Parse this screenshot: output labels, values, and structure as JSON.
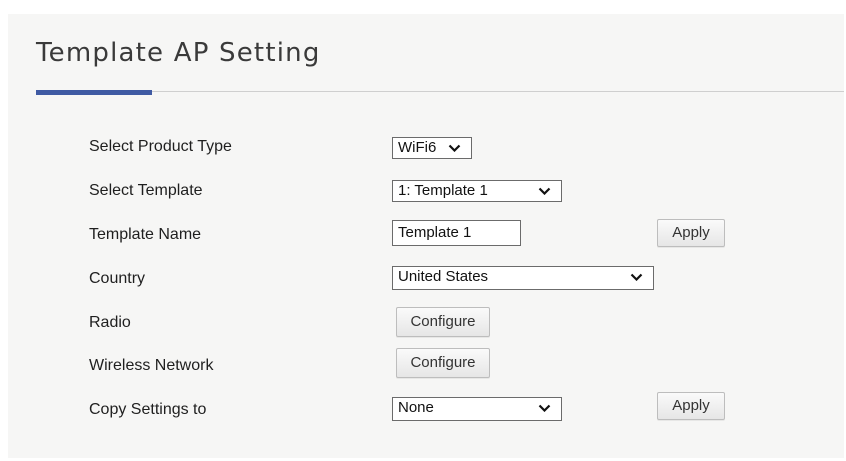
{
  "page": {
    "title": "Template AP Setting"
  },
  "rows": {
    "product_type": {
      "label": "Select Product Type",
      "value": "WiFi6"
    },
    "template": {
      "label": "Select Template",
      "value": "1: Template 1"
    },
    "template_name": {
      "label": "Template Name",
      "value": "Template 1",
      "apply_label": "Apply"
    },
    "country": {
      "label": "Country",
      "value": "United States"
    },
    "radio": {
      "label": "Radio",
      "button_label": "Configure"
    },
    "wireless_network": {
      "label": "Wireless Network",
      "button_label": "Configure"
    },
    "copy_settings": {
      "label": "Copy Settings to",
      "value": "None",
      "apply_label": "Apply"
    }
  },
  "colors": {
    "accent": "#3f5aa3",
    "panel_bg": "#f6f6f5",
    "rule": "#cfcfcf"
  },
  "icons": {
    "select_chevron": "chevron-down-icon"
  }
}
